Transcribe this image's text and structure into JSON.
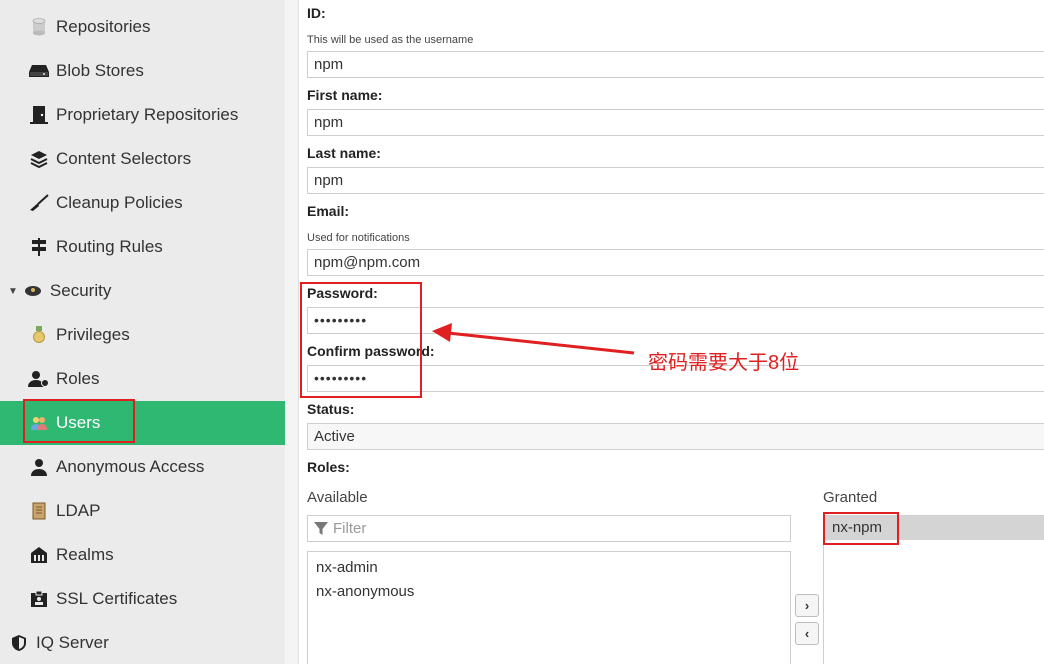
{
  "sidebar": {
    "items": [
      {
        "label": "Repositories",
        "icon": "database-icon"
      },
      {
        "label": "Blob Stores",
        "icon": "hard-drive-icon"
      },
      {
        "label": "Proprietary Repositories",
        "icon": "door-icon"
      },
      {
        "label": "Content Selectors",
        "icon": "layers-icon"
      },
      {
        "label": "Cleanup Policies",
        "icon": "broom-icon"
      },
      {
        "label": "Routing Rules",
        "icon": "signpost-icon"
      },
      {
        "label": "Security",
        "icon": "police-hat-icon"
      },
      {
        "label": "Privileges",
        "icon": "medal-icon"
      },
      {
        "label": "Roles",
        "icon": "user-gear-icon"
      },
      {
        "label": "Users",
        "icon": "users-icon"
      },
      {
        "label": "Anonymous Access",
        "icon": "user-icon"
      },
      {
        "label": "LDAP",
        "icon": "book-icon"
      },
      {
        "label": "Realms",
        "icon": "realm-icon"
      },
      {
        "label": "SSL Certificates",
        "icon": "id-badge-icon"
      },
      {
        "label": "IQ Server",
        "icon": "shield-icon"
      }
    ],
    "active_color": "#2eb872"
  },
  "form": {
    "id_label": "ID:",
    "id_help": "This will be used as the username",
    "id_value": "npm",
    "first_name_label": "First name:",
    "first_name_value": "npm",
    "last_name_label": "Last name:",
    "last_name_value": "npm",
    "email_label": "Email:",
    "email_help": "Used for notifications",
    "email_value": "npm@npm.com",
    "password_label": "Password:",
    "password_value": "•••••••••",
    "confirm_password_label": "Confirm password:",
    "confirm_password_value": "•••••••••",
    "status_label": "Status:",
    "status_value": "Active",
    "roles_label": "Roles:",
    "available_label": "Available",
    "filter_placeholder": "Filter",
    "available_roles": [
      "nx-admin",
      "nx-anonymous"
    ],
    "granted_label": "Granted",
    "granted_roles": [
      "nx-npm"
    ],
    "move_right_glyph": "›",
    "move_left_glyph": "‹"
  },
  "annotation": {
    "text": "密码需要大于8位",
    "color": "#e02020"
  }
}
